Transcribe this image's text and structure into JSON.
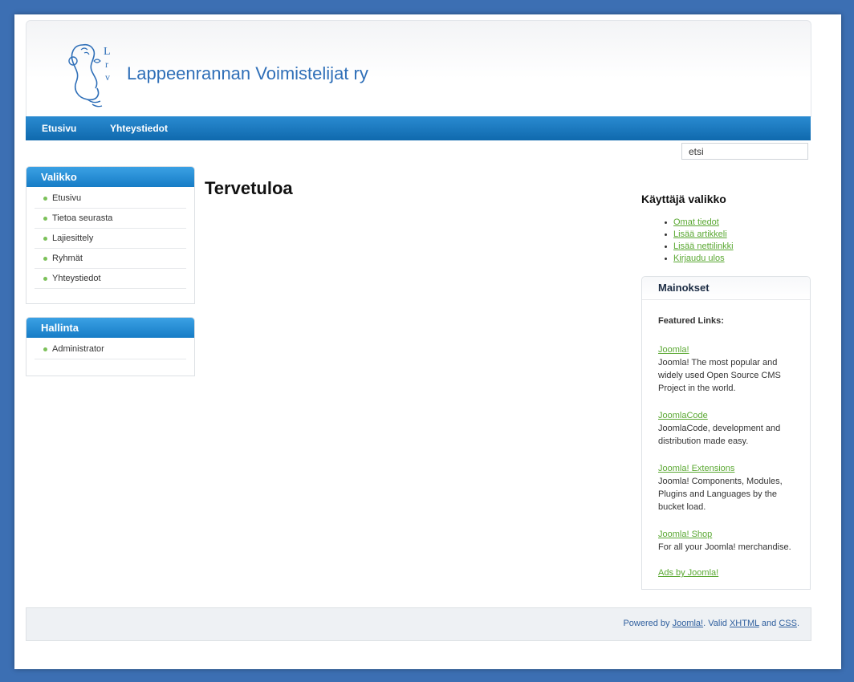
{
  "site": {
    "logo_letters": [
      "L",
      "r",
      "v"
    ],
    "title": "Lappeenrannan Voimistelijat ry"
  },
  "nav": {
    "items": [
      {
        "label": "Etusivu"
      },
      {
        "label": "Yhteystiedot"
      }
    ]
  },
  "search": {
    "value": "etsi"
  },
  "left": {
    "valikko": {
      "title": "Valikko",
      "items": [
        {
          "label": "Etusivu"
        },
        {
          "label": "Tietoa seurasta"
        },
        {
          "label": "Lajiesittely"
        },
        {
          "label": "Ryhmät"
        },
        {
          "label": "Yhteystiedot"
        }
      ]
    },
    "hallinta": {
      "title": "Hallinta",
      "items": [
        {
          "label": "Administrator"
        }
      ]
    }
  },
  "main": {
    "title": "Tervetuloa"
  },
  "right": {
    "user_menu": {
      "title": "Käyttäjä valikko",
      "items": [
        {
          "label": "Omat tiedot"
        },
        {
          "label": "Lisää artikkeli"
        },
        {
          "label": "Lisää nettilinkki"
        },
        {
          "label": "Kirjaudu ulos"
        }
      ]
    },
    "ads": {
      "title": "Mainokset",
      "featured": "Featured Links:",
      "items": [
        {
          "link": "Joomla!",
          "text": "Joomla! The most popular and widely used Open Source CMS Project in the world."
        },
        {
          "link": "JoomlaCode",
          "text": "JoomlaCode, development and distribution made easy."
        },
        {
          "link": "Joomla! Extensions",
          "text": "Joomla! Components, Modules, Plugins and Languages by the bucket load."
        },
        {
          "link": "Joomla! Shop",
          "text": "For all your Joomla! merchandise."
        }
      ],
      "ads_by": "Ads by Joomla!"
    }
  },
  "footer": {
    "powered": "Powered by",
    "joomla": "Joomla!",
    "valid": ". Valid",
    "xhtml": "XHTML",
    "and": "and",
    "css": "CSS",
    "end": "."
  },
  "colors": {
    "background": "#3c6fb3",
    "nav": "#1a7bc4",
    "link": "#5aa832",
    "title": "#2f6fb8"
  }
}
